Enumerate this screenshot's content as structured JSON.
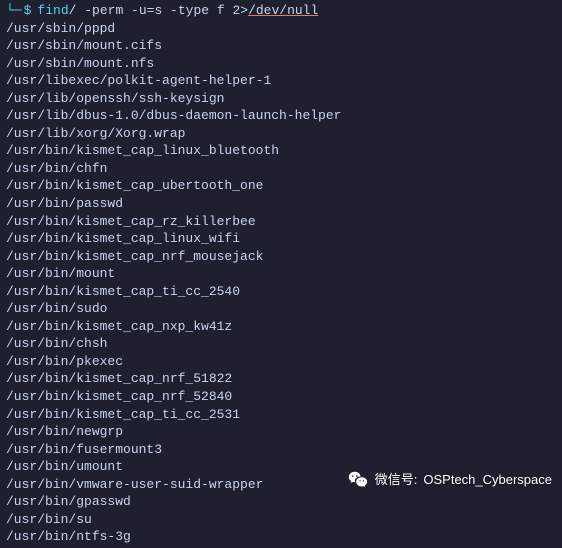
{
  "prompt": {
    "bracket_left": "└─",
    "dollar": "$",
    "command": "find",
    "args": " / -perm -u=s -type f 2>",
    "redirect": "/dev/null"
  },
  "output": [
    "/usr/sbin/pppd",
    "/usr/sbin/mount.cifs",
    "/usr/sbin/mount.nfs",
    "/usr/libexec/polkit-agent-helper-1",
    "/usr/lib/openssh/ssh-keysign",
    "/usr/lib/dbus-1.0/dbus-daemon-launch-helper",
    "/usr/lib/xorg/Xorg.wrap",
    "/usr/bin/kismet_cap_linux_bluetooth",
    "/usr/bin/chfn",
    "/usr/bin/kismet_cap_ubertooth_one",
    "/usr/bin/passwd",
    "/usr/bin/kismet_cap_rz_killerbee",
    "/usr/bin/kismet_cap_linux_wifi",
    "/usr/bin/kismet_cap_nrf_mousejack",
    "/usr/bin/mount",
    "/usr/bin/kismet_cap_ti_cc_2540",
    "/usr/bin/sudo",
    "/usr/bin/kismet_cap_nxp_kw41z",
    "/usr/bin/chsh",
    "/usr/bin/pkexec",
    "/usr/bin/kismet_cap_nrf_51822",
    "/usr/bin/kismet_cap_nrf_52840",
    "/usr/bin/kismet_cap_ti_cc_2531",
    "/usr/bin/newgrp",
    "/usr/bin/fusermount3",
    "/usr/bin/umount",
    "/usr/bin/vmware-user-suid-wrapper",
    "/usr/bin/gpasswd",
    "/usr/bin/su",
    "/usr/bin/ntfs-3g"
  ],
  "watermark": {
    "prefix": "微信号:",
    "name": "OSPtech_Cyberspace"
  }
}
